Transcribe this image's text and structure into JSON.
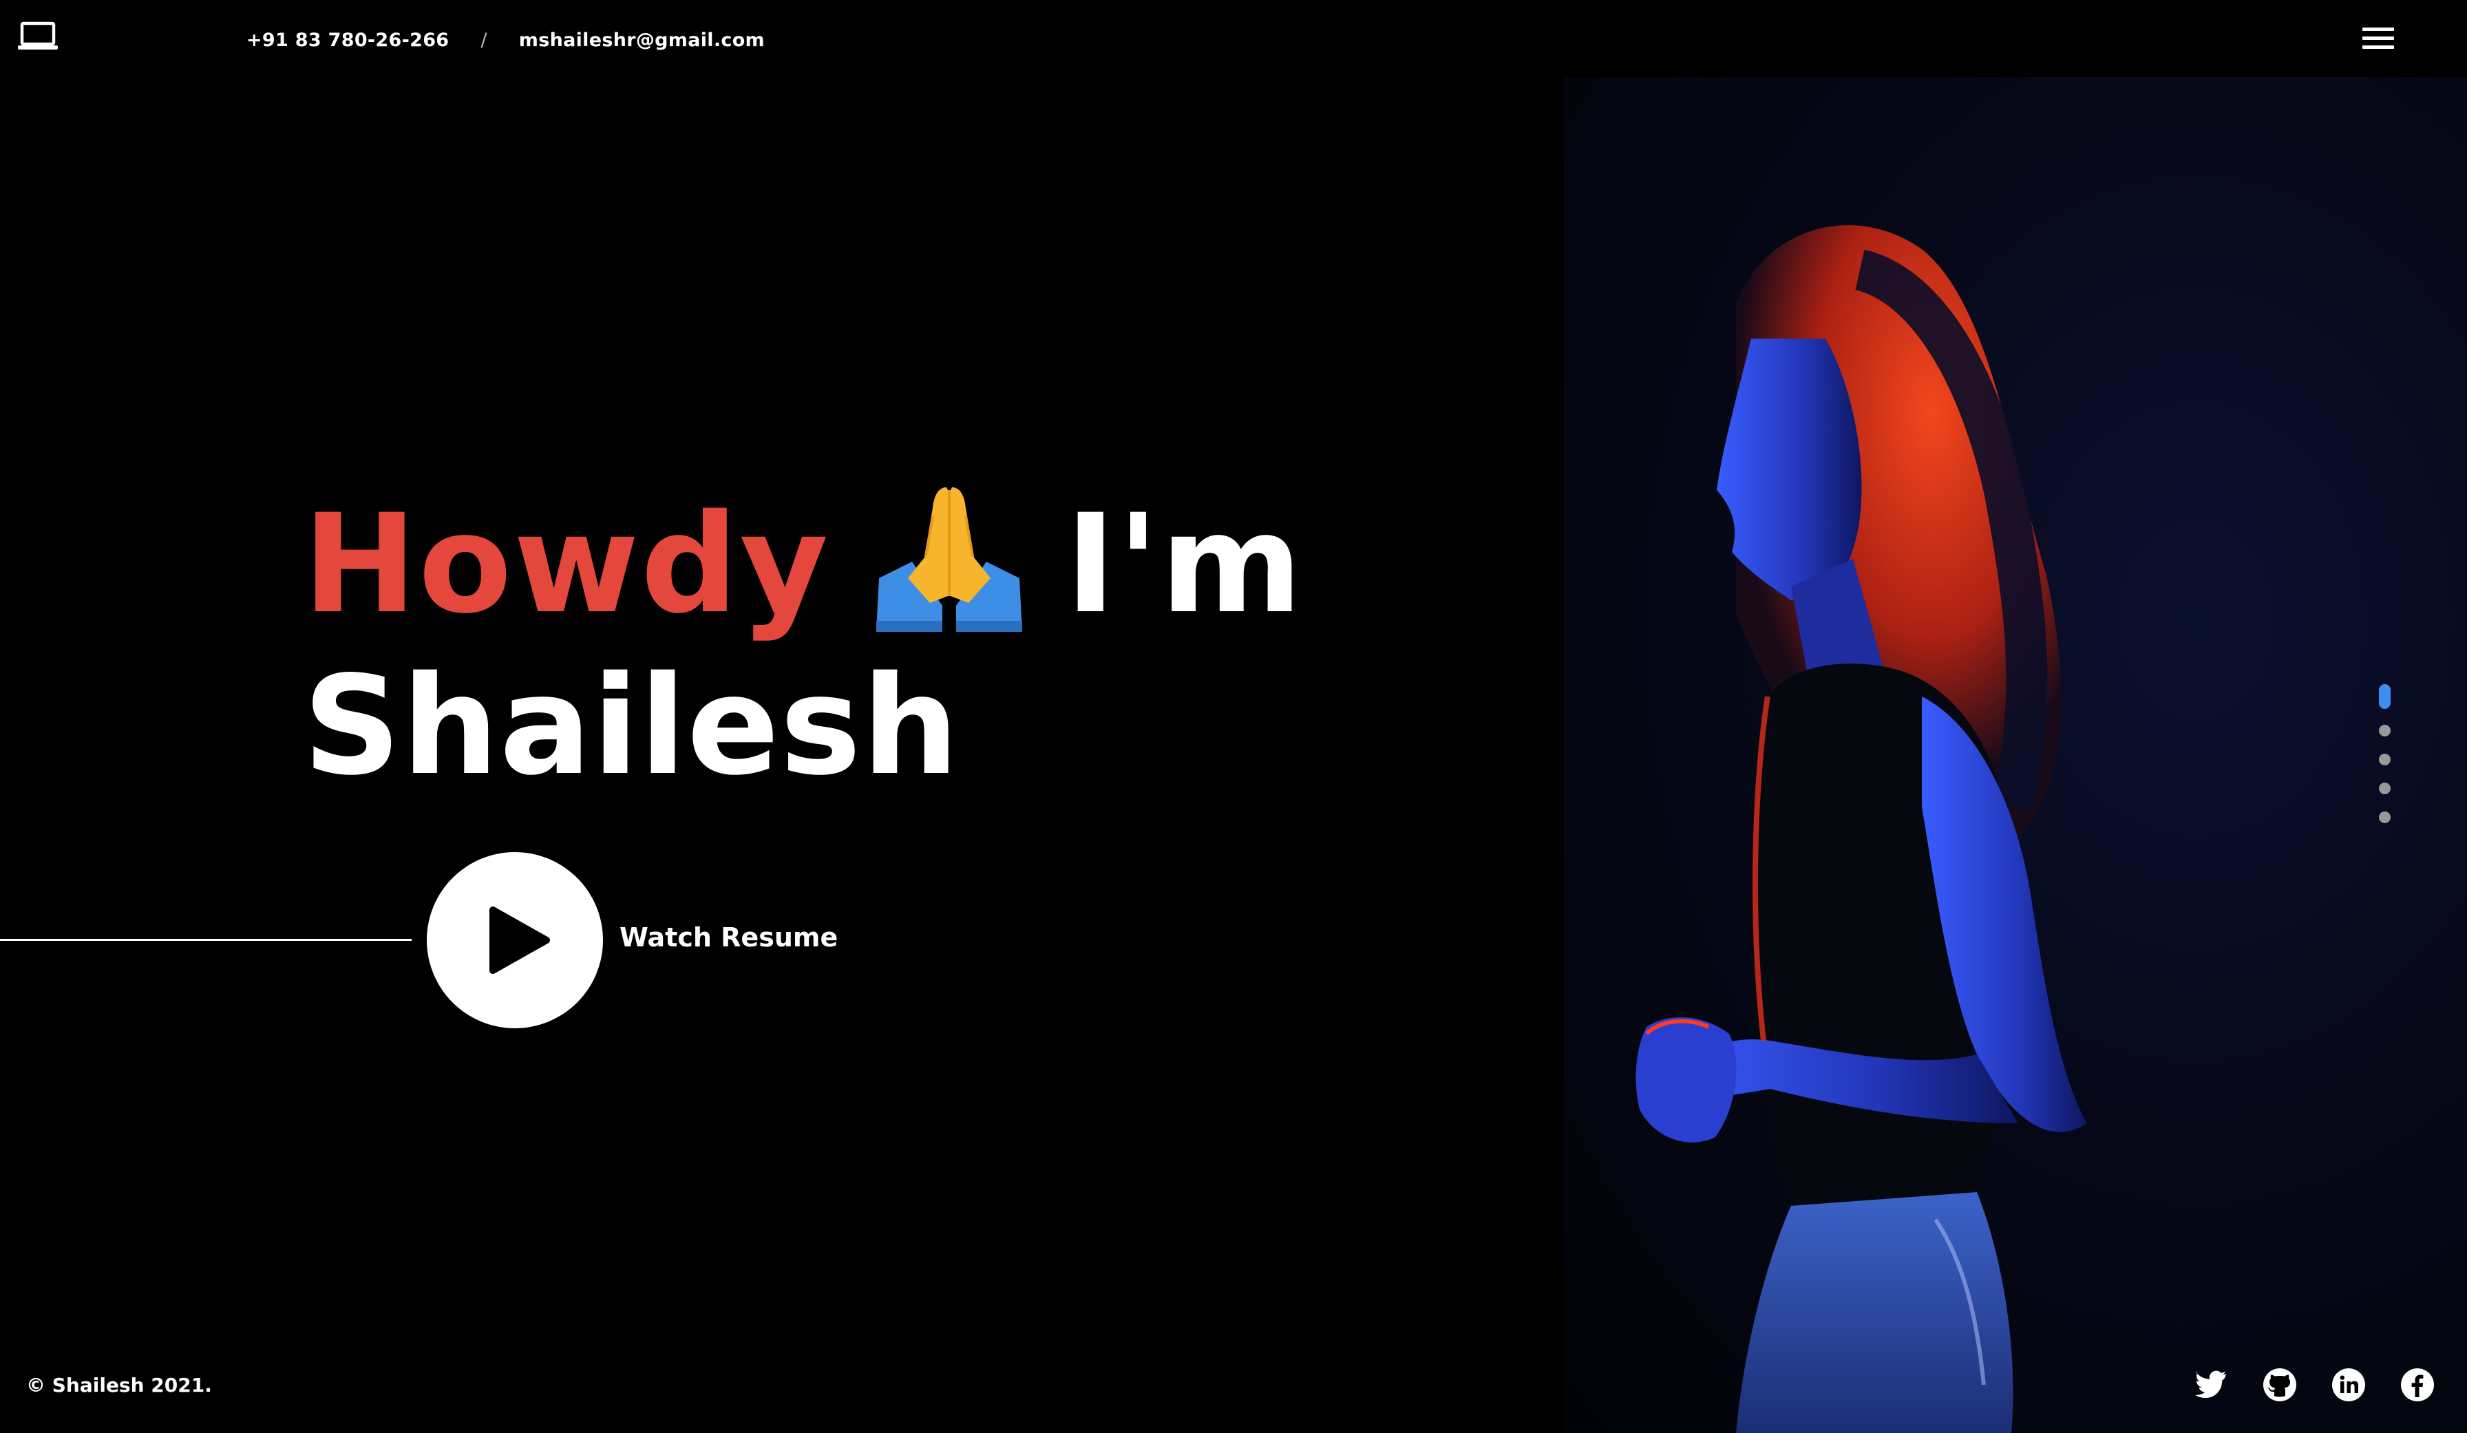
{
  "header": {
    "phone": "+91 83 780-26-266",
    "separator": "/",
    "email": "mshaileshr@gmail.com"
  },
  "hero": {
    "greeting": "Howdy",
    "emoji": "🙏",
    "im": "I'm",
    "name": "Shailesh"
  },
  "resume": {
    "label": "Watch Resume"
  },
  "footer": {
    "copyright": "© Shailesh 2021."
  },
  "pagination": {
    "total": 5,
    "active_index": 0
  },
  "icons": {
    "logo": "laptop-icon",
    "menu": "hamburger-menu-icon",
    "play": "play-icon",
    "socials": [
      "twitter-icon",
      "github-icon",
      "linkedin-icon",
      "facebook-icon"
    ]
  },
  "colors": {
    "background": "#000000",
    "accent_red": "#e4473c",
    "active_dot": "#3d8ef0",
    "inactive_dot": "#999999",
    "text": "#ffffff"
  }
}
